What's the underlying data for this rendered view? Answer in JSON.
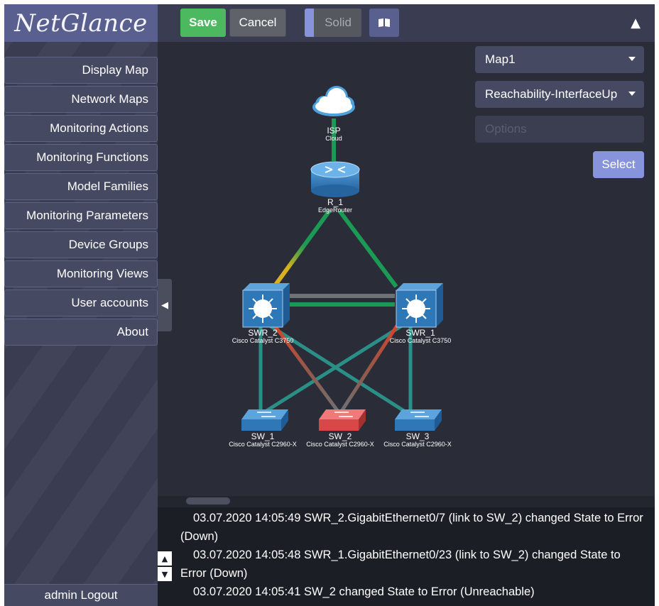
{
  "app": {
    "logo": "NetGlance"
  },
  "toolbar": {
    "save_label": "Save",
    "cancel_label": "Cancel",
    "solid_label": "Solid",
    "book_icon": "book-icon",
    "collapse_icon": "triangle-up-icon"
  },
  "sidebar": {
    "items": [
      {
        "label": "Display Map"
      },
      {
        "label": "Network Maps"
      },
      {
        "label": "Monitoring Actions"
      },
      {
        "label": "Monitoring Functions"
      },
      {
        "label": "Model Families"
      },
      {
        "label": "Monitoring Parameters"
      },
      {
        "label": "Device Groups"
      },
      {
        "label": "Monitoring Views"
      },
      {
        "label": "User accounts"
      },
      {
        "label": "About"
      }
    ],
    "logout_label": "admin Logout"
  },
  "controls": {
    "map_select": "Map1",
    "rule_select": "Reachability-InterfaceUp",
    "options_placeholder": "Options",
    "select_label": "Select"
  },
  "map": {
    "nodes": {
      "isp": {
        "name": "ISP",
        "model": "Cloud"
      },
      "r1": {
        "name": "R_1",
        "model": "EdgeRouter"
      },
      "swr2": {
        "name": "SWR_2",
        "model": "Cisco Catalyst C3750"
      },
      "swr1": {
        "name": "SWR_1",
        "model": "Cisco Catalyst C3750"
      },
      "sw1": {
        "name": "SW_1",
        "model": "Cisco Catalyst C2960-X"
      },
      "sw2": {
        "name": "SW_2",
        "model": "Cisco Catalyst C2960-X"
      },
      "sw3": {
        "name": "SW_3",
        "model": "Cisco Catalyst C2960-X"
      }
    },
    "colors": {
      "link_up": "#1a9a55",
      "link_teal": "#2a8f86",
      "link_gray": "#6d7275",
      "link_error": "#d6442c",
      "link_warning": "#d8b21e",
      "device_blue": "#2e78b7",
      "device_error": "#d84848"
    }
  },
  "log": {
    "entries": [
      "03.07.2020 14:05:49  SWR_2.GigabitEthernet0/7  (link to SW_2) changed State to Error (Down)",
      "03.07.2020 14:05:48  SWR_1.GigabitEthernet0/23  (link to SW_2) changed State to Error (Down)",
      "03.07.2020 14:05:41  SW_2  changed State to  Error (Unreachable)"
    ]
  }
}
